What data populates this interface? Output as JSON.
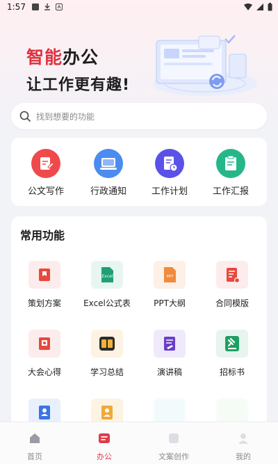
{
  "status_bar": {
    "time": "1:57"
  },
  "hero": {
    "title_accent": "智能",
    "title_rest": "办公",
    "subtitle": "让工作更有趣!"
  },
  "search": {
    "placeholder": "找到想要的功能"
  },
  "quick_actions": [
    {
      "label": "公文写作",
      "icon": "pencil-doc-icon",
      "color": "#f0494c"
    },
    {
      "label": "行政通知",
      "icon": "monitor-icon",
      "color": "#4a8cf0"
    },
    {
      "label": "工作计划",
      "icon": "doc-clock-icon",
      "color": "#5a52e8"
    },
    {
      "label": "工作汇报",
      "icon": "clipboard-icon",
      "color": "#25b78a"
    }
  ],
  "common": {
    "title": "常用功能",
    "items": [
      {
        "label": "策划方案",
        "icon": "plan-bookmark-icon"
      },
      {
        "label": "Excel公式表",
        "icon": "excel-icon"
      },
      {
        "label": "PPT大纲",
        "icon": "ppt-icon"
      },
      {
        "label": "合同模版",
        "icon": "contract-icon"
      },
      {
        "label": "大会心得",
        "icon": "meeting-notes-icon"
      },
      {
        "label": "学习总结",
        "icon": "book-icon"
      },
      {
        "label": "演讲稿",
        "icon": "speech-doc-icon"
      },
      {
        "label": "招标书",
        "icon": "gavel-icon"
      }
    ]
  },
  "tabbar": {
    "tabs": [
      {
        "label": "首页",
        "icon": "home-icon",
        "active": false
      },
      {
        "label": "办公",
        "icon": "office-icon",
        "active": true
      },
      {
        "label": "文案创作",
        "icon": "copywriting-icon",
        "active": false
      },
      {
        "label": "我的",
        "icon": "profile-icon",
        "active": false
      }
    ]
  },
  "colors": {
    "accent": "#e0323f",
    "active_tab": "#e03a48"
  }
}
